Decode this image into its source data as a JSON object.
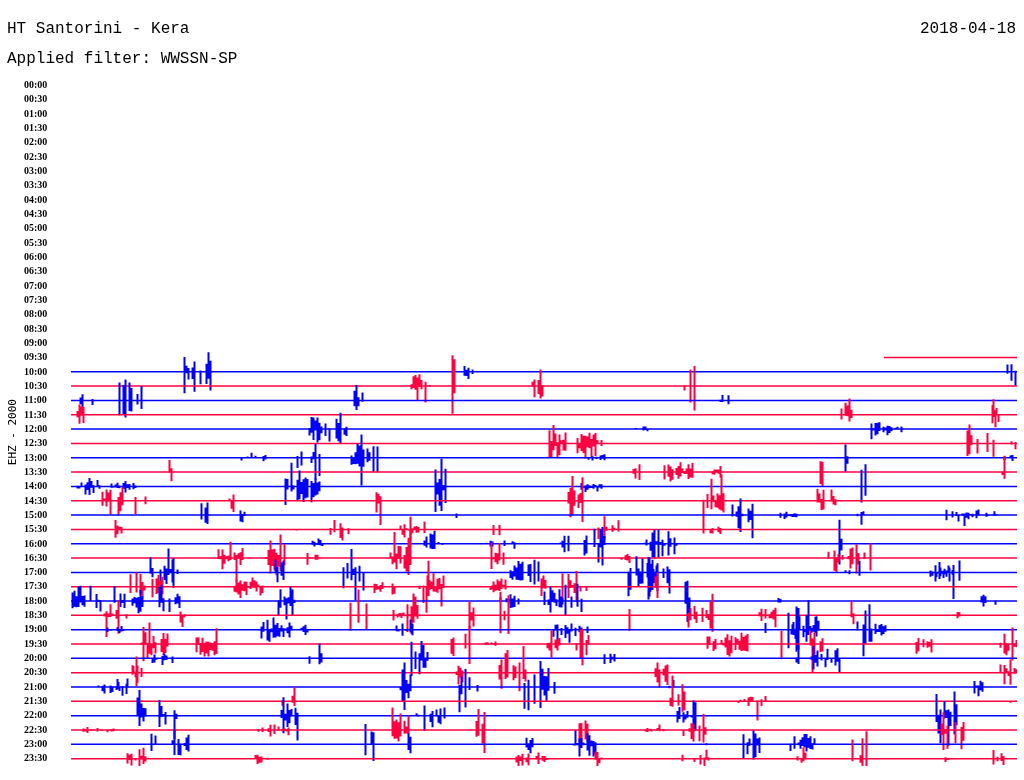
{
  "header": {
    "title": "HT Santorini - Kera",
    "date": "2018-04-18",
    "filter": "Applied filter: WWSSN-SP"
  },
  "axis_label": "EHZ - 2000",
  "time_labels": [
    "00:00",
    "00:30",
    "01:00",
    "01:30",
    "02:00",
    "02:30",
    "03:00",
    "03:30",
    "04:00",
    "04:30",
    "05:00",
    "05:30",
    "06:00",
    "06:30",
    "07:00",
    "07:30",
    "08:00",
    "08:30",
    "09:00",
    "09:30",
    "10:00",
    "10:30",
    "11:00",
    "11:30",
    "12:00",
    "12:30",
    "13:00",
    "13:30",
    "14:00",
    "14:30",
    "15:00",
    "15:30",
    "16:00",
    "16:30",
    "17:00",
    "17:30",
    "18:00",
    "18:30",
    "19:00",
    "19:30",
    "20:00",
    "20:30",
    "21:00",
    "21:30",
    "22:00",
    "22:30",
    "23:00",
    "23:30"
  ]
}
